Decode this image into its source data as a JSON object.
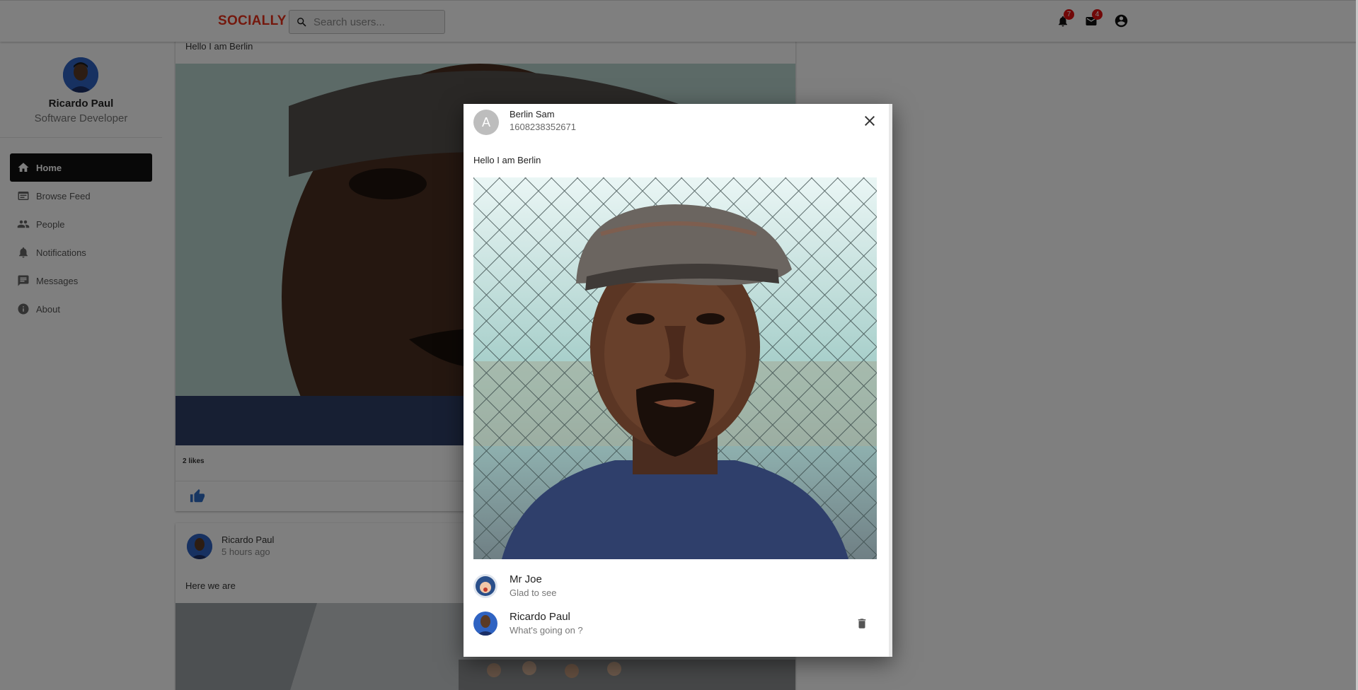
{
  "app": {
    "logo": "SOCIALLY"
  },
  "header": {
    "search": {
      "placeholder": "Search users...",
      "value": ""
    },
    "notifications_count": "7",
    "messages_count": "4"
  },
  "sidebar": {
    "profile": {
      "name": "Ricardo Paul",
      "role": "Software Developer"
    },
    "items": [
      {
        "label": "Home",
        "icon": "home-icon",
        "active": true
      },
      {
        "label": "Browse Feed",
        "icon": "feed-icon"
      },
      {
        "label": "People",
        "icon": "people-icon"
      },
      {
        "label": "Notifications",
        "icon": "bell-icon"
      },
      {
        "label": "Messages",
        "icon": "chat-icon"
      },
      {
        "label": "About",
        "icon": "info-icon"
      }
    ]
  },
  "feed": {
    "post1": {
      "text": "Hello I am Berlin",
      "likes": "2 likes"
    },
    "post2": {
      "author": "Ricardo Paul",
      "time": "5 hours ago",
      "text": "Here we are"
    }
  },
  "modal": {
    "author_initial": "A",
    "author": "Berlin Sam",
    "timestamp": "1608238352671",
    "text": "Hello I am Berlin",
    "comments": [
      {
        "name": "Mr Joe",
        "text": "Glad to see",
        "deletable": false
      },
      {
        "name": "Ricardo Paul",
        "text": "What's going on ?",
        "deletable": true
      }
    ]
  },
  "colors": {
    "brand": "#e8311a",
    "badge": "#e21010",
    "active_nav": "#111111"
  }
}
